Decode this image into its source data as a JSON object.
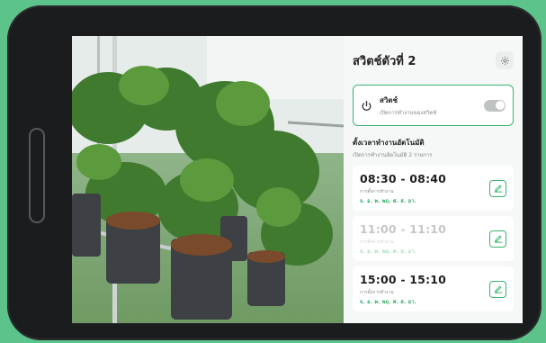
{
  "panel": {
    "title": "สวิตช์ตัวที่ 2",
    "settings_icon": "gear-icon"
  },
  "switch": {
    "icon": "power-icon",
    "title": "สวิตช์",
    "subtitle": "เปิดการทำงานของสวิตช์",
    "is_on": false
  },
  "schedule": {
    "title": "ตั้งเวลาทำงานอัตโนมัติ",
    "subtitle": "เปิดการทำงานอัตโนมัติ 2 รายการ",
    "items": [
      {
        "time": "08:30 - 08:40",
        "label": "การตั้งการทำงาน",
        "days": "จ. อ. พ. พฤ. ศ. ส. อา.",
        "enabled": true,
        "edit_icon": "pencil-icon"
      },
      {
        "time": "11:00 - 11:10",
        "label": "การตั้งการทำงาน",
        "days": "จ. อ. พ. พฤ. ศ. ส. อา.",
        "enabled": false,
        "edit_icon": "pencil-icon"
      },
      {
        "time": "15:00 - 15:10",
        "label": "การตั้งการทำงาน",
        "days": "จ. อ. พ. พฤ. ศ. ส. อา.",
        "enabled": true,
        "edit_icon": "pencil-icon"
      }
    ]
  },
  "colors": {
    "accent": "#3bb46f",
    "background": "#5cc48a",
    "device": "#1b1c1e"
  }
}
